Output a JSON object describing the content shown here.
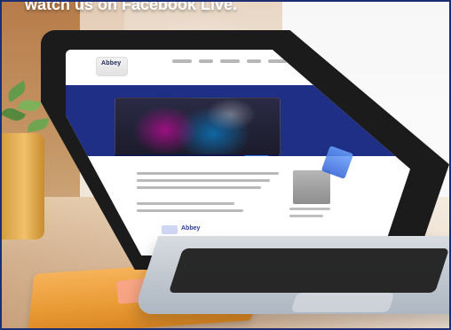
{
  "caption": {
    "text": "watch us on Facebook Live."
  },
  "website": {
    "logo_text": "Abbey"
  },
  "colors": {
    "frame_border": "#1c2f74",
    "hero_blue": "#1f2f86",
    "accent_blue": "#2d74d2",
    "text_grey": "#b9b9b9"
  }
}
